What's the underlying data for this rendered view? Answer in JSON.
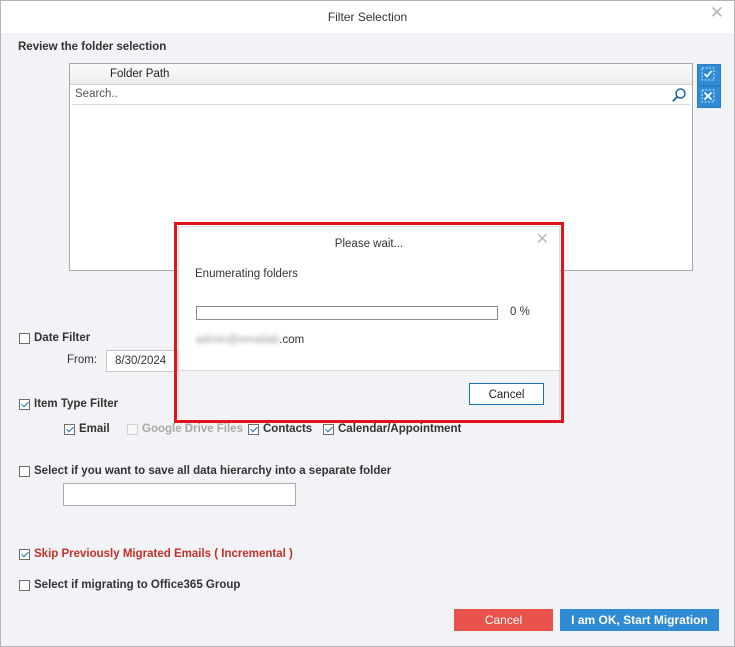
{
  "window": {
    "title": "Filter Selection",
    "close_glyph": "✕"
  },
  "folder_selection": {
    "section_label": "Review the folder selection",
    "column_header": "Folder Path",
    "search_placeholder": "Search.."
  },
  "date_filter": {
    "label": "Date Filter",
    "checked": false,
    "from_label": "From:",
    "from_value": "8/30/2024"
  },
  "item_type_filter": {
    "label": "Item Type Filter",
    "checked": true,
    "items": [
      {
        "label": "Email",
        "checked": true,
        "enabled": true
      },
      {
        "label": "Google Drive Files",
        "checked": false,
        "enabled": false
      },
      {
        "label": "Contacts",
        "checked": true,
        "enabled": true
      },
      {
        "label": "Calendar/Appointment",
        "checked": true,
        "enabled": true
      }
    ]
  },
  "hierarchy": {
    "label": "Select if you want to save all data hierarchy into a separate folder",
    "checked": false,
    "value": ""
  },
  "skip_migrated": {
    "label": "Skip Previously Migrated Emails ( Incremental )",
    "checked": true
  },
  "office365_group": {
    "label": "Select if migrating to Office365 Group",
    "checked": false
  },
  "buttons": {
    "cancel": "Cancel",
    "start": "I am OK, Start Migration"
  },
  "modal": {
    "title": "Please wait...",
    "close_glyph": "✕",
    "message": "Enumerating folders",
    "progress_percent": 0,
    "progress_label": "0 %",
    "email_blurred": "admin@emailab",
    "email_suffix": ".com",
    "cancel_label": "Cancel"
  },
  "colors": {
    "accent": "#2f8bd3",
    "danger": "#e8524a",
    "highlight_outline": "#e0141b"
  }
}
